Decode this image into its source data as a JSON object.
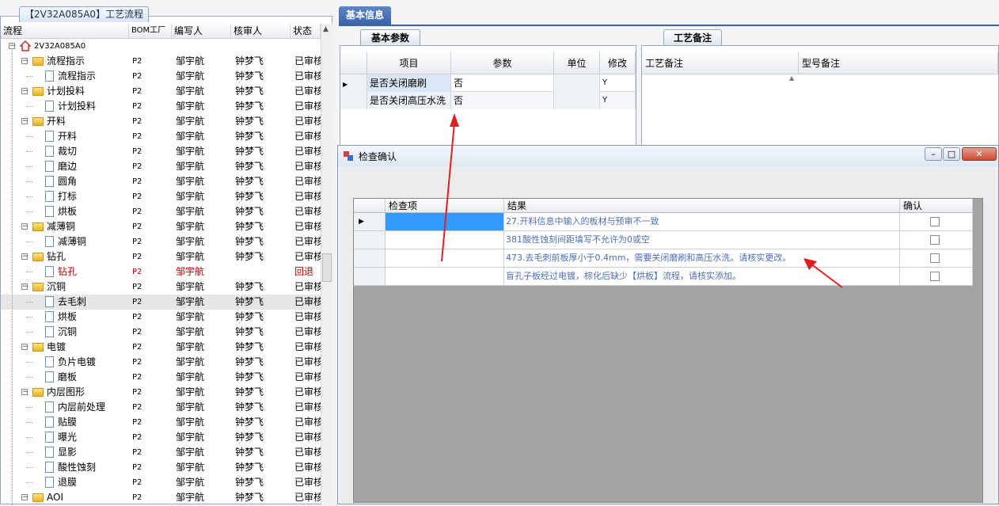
{
  "left_panel": {
    "tab_label": "【2V32A085A0】工艺流程",
    "columns": [
      "流程",
      "BOM工厂",
      "编写人",
      "核审人",
      "状态"
    ],
    "rows": [
      {
        "level": 0,
        "kind": "root",
        "name": "2V32A085A0",
        "bom": "",
        "writer": "",
        "reviewer": "",
        "status": ""
      },
      {
        "level": 1,
        "kind": "folder",
        "name": "流程指示",
        "bom": "P2",
        "writer": "邹宇航",
        "reviewer": "钟梦飞",
        "status": "已审核"
      },
      {
        "level": 2,
        "kind": "doc",
        "name": "流程指示",
        "bom": "P2",
        "writer": "邹宇航",
        "reviewer": "钟梦飞",
        "status": "已审核"
      },
      {
        "level": 1,
        "kind": "folder",
        "name": "计划投料",
        "bom": "P2",
        "writer": "邹宇航",
        "reviewer": "钟梦飞",
        "status": "已审核"
      },
      {
        "level": 2,
        "kind": "doc",
        "name": "计划投料",
        "bom": "P2",
        "writer": "邹宇航",
        "reviewer": "钟梦飞",
        "status": "已审核"
      },
      {
        "level": 1,
        "kind": "folder",
        "name": "开料",
        "bom": "P2",
        "writer": "邹宇航",
        "reviewer": "钟梦飞",
        "status": "已审核"
      },
      {
        "level": 2,
        "kind": "doc",
        "name": "开料",
        "bom": "P2",
        "writer": "邹宇航",
        "reviewer": "钟梦飞",
        "status": "已审核"
      },
      {
        "level": 2,
        "kind": "doc",
        "name": "裁切",
        "bom": "P2",
        "writer": "邹宇航",
        "reviewer": "钟梦飞",
        "status": "已审核"
      },
      {
        "level": 2,
        "kind": "doc",
        "name": "磨边",
        "bom": "P2",
        "writer": "邹宇航",
        "reviewer": "钟梦飞",
        "status": "已审核"
      },
      {
        "level": 2,
        "kind": "doc",
        "name": "圆角",
        "bom": "P2",
        "writer": "邹宇航",
        "reviewer": "钟梦飞",
        "status": "已审核"
      },
      {
        "level": 2,
        "kind": "doc",
        "name": "打标",
        "bom": "P2",
        "writer": "邹宇航",
        "reviewer": "钟梦飞",
        "status": "已审核"
      },
      {
        "level": 2,
        "kind": "doc",
        "name": "烘板",
        "bom": "P2",
        "writer": "邹宇航",
        "reviewer": "钟梦飞",
        "status": "已审核"
      },
      {
        "level": 1,
        "kind": "folder",
        "name": "减薄铜",
        "bom": "P2",
        "writer": "邹宇航",
        "reviewer": "钟梦飞",
        "status": "已审核"
      },
      {
        "level": 2,
        "kind": "doc",
        "name": "减薄铜",
        "bom": "P2",
        "writer": "邹宇航",
        "reviewer": "钟梦飞",
        "status": "已审核"
      },
      {
        "level": 1,
        "kind": "folder",
        "name": "钻孔",
        "bom": "P2",
        "writer": "邹宇航",
        "reviewer": "钟梦飞",
        "status": "已审核"
      },
      {
        "level": 2,
        "kind": "doc",
        "name": "钻孔",
        "bom": "P2",
        "writer": "邹宇航",
        "reviewer": "",
        "status": "回退",
        "red": true
      },
      {
        "level": 1,
        "kind": "folder",
        "name": "沉铜",
        "bom": "P2",
        "writer": "邹宇航",
        "reviewer": "钟梦飞",
        "status": "已审核"
      },
      {
        "level": 2,
        "kind": "doc",
        "name": "去毛刺",
        "bom": "P2",
        "writer": "邹宇航",
        "reviewer": "钟梦飞",
        "status": "已审核",
        "selected": true
      },
      {
        "level": 2,
        "kind": "doc",
        "name": "烘板",
        "bom": "P2",
        "writer": "邹宇航",
        "reviewer": "钟梦飞",
        "status": "已审核"
      },
      {
        "level": 2,
        "kind": "doc",
        "name": "沉铜",
        "bom": "P2",
        "writer": "邹宇航",
        "reviewer": "钟梦飞",
        "status": "已审核"
      },
      {
        "level": 1,
        "kind": "folder",
        "name": "电镀",
        "bom": "P2",
        "writer": "邹宇航",
        "reviewer": "钟梦飞",
        "status": "已审核"
      },
      {
        "level": 2,
        "kind": "doc",
        "name": "负片电镀",
        "bom": "P2",
        "writer": "邹宇航",
        "reviewer": "钟梦飞",
        "status": "已审核"
      },
      {
        "level": 2,
        "kind": "doc",
        "name": "磨板",
        "bom": "P2",
        "writer": "邹宇航",
        "reviewer": "钟梦飞",
        "status": "已审核"
      },
      {
        "level": 1,
        "kind": "folder",
        "name": "内层图形",
        "bom": "P2",
        "writer": "邹宇航",
        "reviewer": "钟梦飞",
        "status": "已审核"
      },
      {
        "level": 2,
        "kind": "doc",
        "name": "内层前处理",
        "bom": "P2",
        "writer": "邹宇航",
        "reviewer": "钟梦飞",
        "status": "已审核"
      },
      {
        "level": 2,
        "kind": "doc",
        "name": "贴膜",
        "bom": "P2",
        "writer": "邹宇航",
        "reviewer": "钟梦飞",
        "status": "已审核"
      },
      {
        "level": 2,
        "kind": "doc",
        "name": "曝光",
        "bom": "P2",
        "writer": "邹宇航",
        "reviewer": "钟梦飞",
        "status": "已审核"
      },
      {
        "level": 2,
        "kind": "doc",
        "name": "显影",
        "bom": "P2",
        "writer": "邹宇航",
        "reviewer": "钟梦飞",
        "status": "已审核"
      },
      {
        "level": 2,
        "kind": "doc",
        "name": "酸性蚀刻",
        "bom": "P2",
        "writer": "邹宇航",
        "reviewer": "钟梦飞",
        "status": "已审核"
      },
      {
        "level": 2,
        "kind": "doc",
        "name": "退膜",
        "bom": "P2",
        "writer": "邹宇航",
        "reviewer": "钟梦飞",
        "status": "已审核"
      },
      {
        "level": 1,
        "kind": "folder",
        "name": "AOI",
        "bom": "P2",
        "writer": "邹宇航",
        "reviewer": "钟梦飞",
        "status": "已审核"
      }
    ]
  },
  "info": {
    "main_tab": "基本信息",
    "basic_tab": "基本参数",
    "basic_columns": [
      "项目",
      "参数",
      "单位",
      "修改"
    ],
    "basic_rows": [
      {
        "item": "是否关闭磨刷",
        "param": "否",
        "unit": "",
        "modify": "Y"
      },
      {
        "item": "是否关闭高压水洗",
        "param": "否",
        "unit": "",
        "modify": "Y"
      }
    ],
    "remark_tab": "工艺备注",
    "remark_columns": [
      "工艺备注",
      "型号备注"
    ]
  },
  "dialog": {
    "title": "检查确认",
    "columns": [
      "检查项",
      "结果",
      "确认"
    ],
    "rows": [
      {
        "item": "",
        "result": "27.开料信息中输入的板材与预审不一致",
        "confirmed": false
      },
      {
        "item": "",
        "result": "381酸性蚀刻间距填写不允许为0或空",
        "confirmed": false
      },
      {
        "item": "",
        "result": "473.去毛刺前板厚小于0.4mm，需要关闭磨刷和高压水洗。请核实更改。",
        "confirmed": false
      },
      {
        "item": "",
        "result": "盲孔子板经过电镀，棕化后缺少【烘板】流程，请核实添加。",
        "confirmed": false
      }
    ]
  },
  "icons": [
    "folder-icon",
    "document-icon",
    "home-icon",
    "row-pointer-icon",
    "minimize-icon",
    "maximize-icon",
    "close-icon"
  ],
  "colors": {
    "accent": "#3a64a8",
    "annotation_arrow": "#e02020",
    "error_text": "#c00000",
    "result_text": "#4d6fb3"
  }
}
